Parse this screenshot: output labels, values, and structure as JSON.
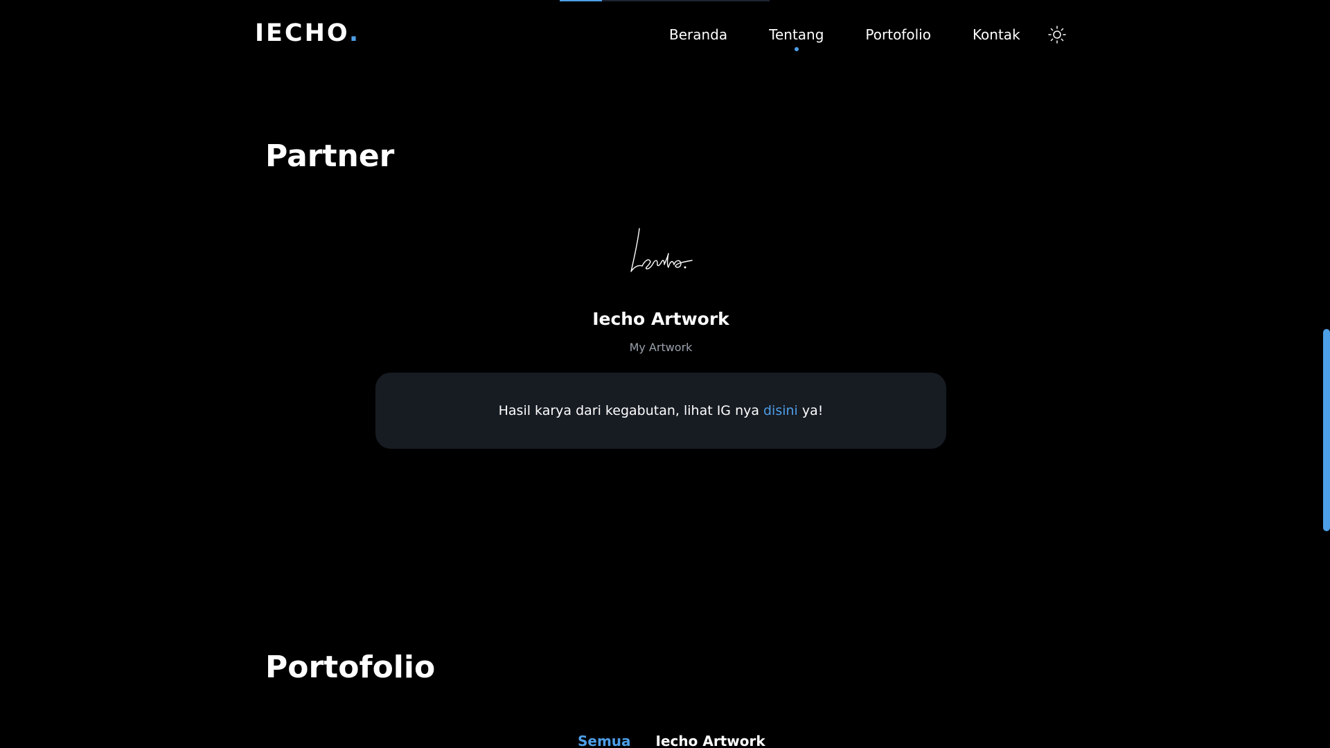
{
  "top_progress": {
    "fill": 0.2
  },
  "header": {
    "logo_text": "IECHO",
    "logo_dot": ".",
    "nav": [
      {
        "label": "Beranda",
        "active": false
      },
      {
        "label": "Tentang",
        "active": true
      },
      {
        "label": "Portofolio",
        "active": false
      },
      {
        "label": "Kontak",
        "active": false
      }
    ],
    "theme_icon": "sun-icon"
  },
  "partner": {
    "section_title": "Partner",
    "logo_signature": "Iecho.",
    "name": "Iecho Artwork",
    "subtitle": "My Artwork",
    "card": {
      "text_before": "Hasil karya dari kegabutan, lihat IG nya",
      "link_text": "disini",
      "text_after": "ya!"
    }
  },
  "portfolio": {
    "section_title": "Portofolio",
    "filters": [
      {
        "label": "Semua",
        "active": true
      },
      {
        "label": "Iecho Artwork",
        "active": false
      }
    ]
  },
  "scrollbar": {
    "position": 0.44,
    "size": 0.27
  },
  "colors": {
    "accent": "#4d9fe8",
    "background": "#000000",
    "card": "#171b22",
    "muted_text": "#9aa1ab"
  }
}
